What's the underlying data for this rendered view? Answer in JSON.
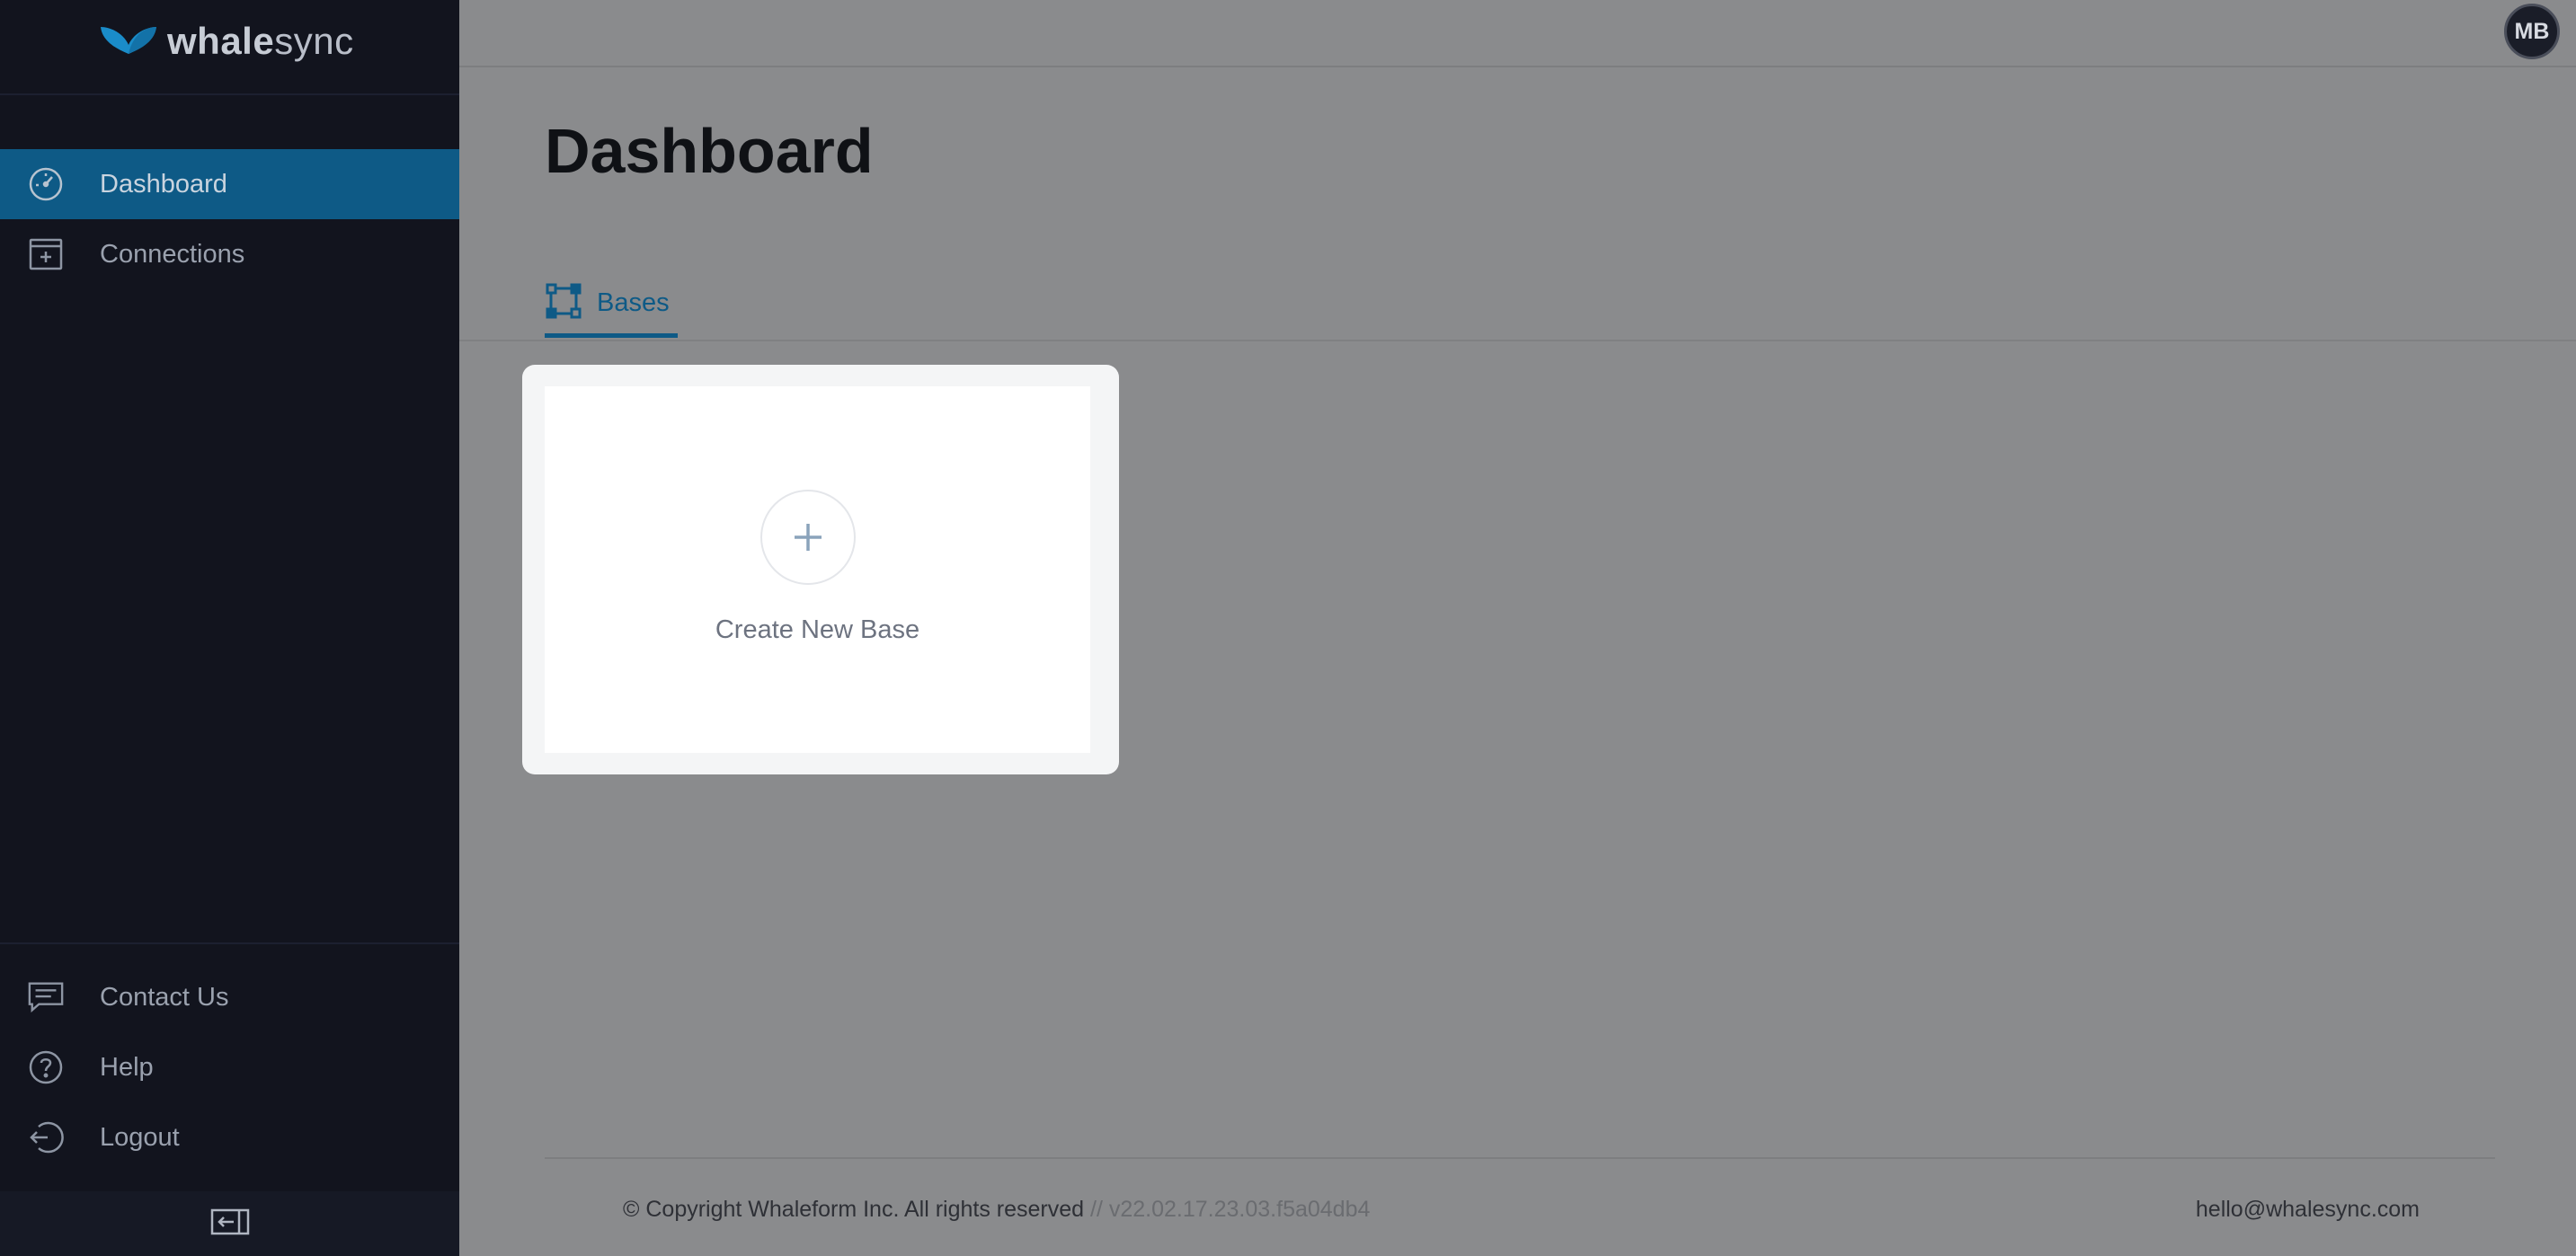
{
  "app": {
    "logo_bold": "whale",
    "logo_light": "sync",
    "logo_icon": "whale-tail-icon",
    "accent_color": "#0e5a86"
  },
  "sidebar": {
    "nav": [
      {
        "label": "Dashboard",
        "icon": "dashboard-gauge-icon",
        "active": true
      },
      {
        "label": "Connections",
        "icon": "connections-window-icon",
        "active": false
      }
    ],
    "bottom": [
      {
        "label": "Contact Us",
        "icon": "chat-icon"
      },
      {
        "label": "Help",
        "icon": "question-circle-icon"
      },
      {
        "label": "Logout",
        "icon": "logout-icon"
      }
    ],
    "collapse_icon": "collapse-sidebar-icon"
  },
  "header": {
    "avatar_initials": "MB"
  },
  "main": {
    "title": "Dashboard",
    "tabs": [
      {
        "label": "Bases",
        "icon": "bases-nodes-icon",
        "active": true
      }
    ],
    "create_card": {
      "label": "Create New Base",
      "icon": "plus-icon"
    }
  },
  "footer": {
    "copyright": "© Copyright Whaleform Inc. All rights reserved",
    "version": "// v22.02.17.23.03.f5a04db4",
    "email": "hello@whalesync.com"
  }
}
